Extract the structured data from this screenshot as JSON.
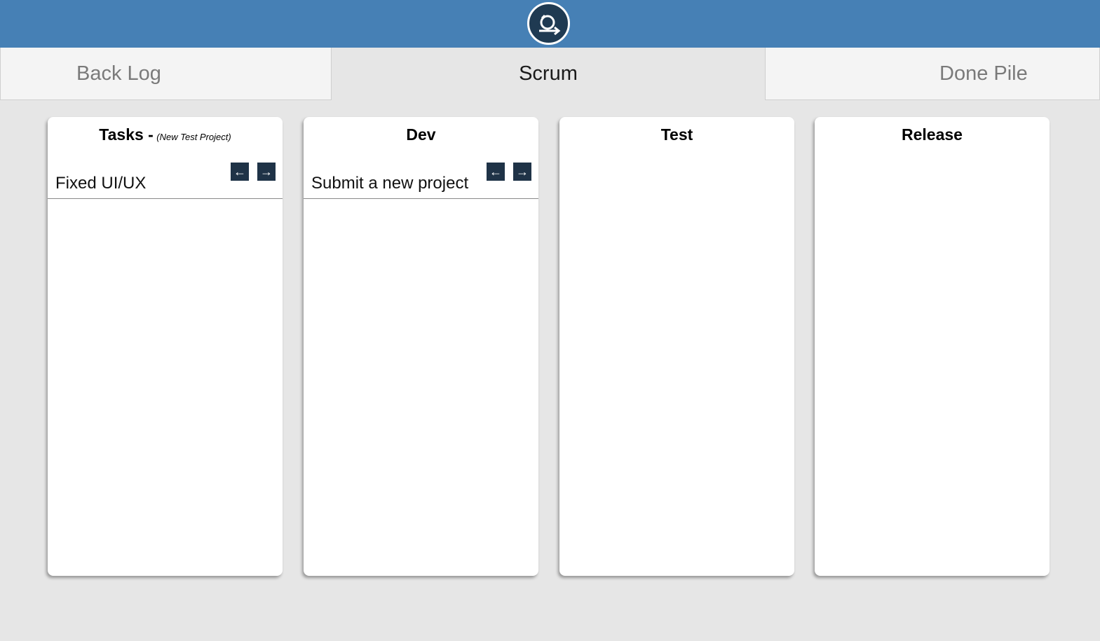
{
  "app": {
    "logo_icon": "scrum-loop-icon"
  },
  "tabs": [
    {
      "label": "Back Log",
      "active": false
    },
    {
      "label": "Scrum",
      "active": true
    },
    {
      "label": "Done Pile",
      "active": false
    }
  ],
  "columns": [
    {
      "title": "Tasks -",
      "subtitle": "(New Test Project)",
      "cards": [
        {
          "text": "Fixed UI/UX"
        }
      ]
    },
    {
      "title": "Dev",
      "cards": [
        {
          "text": "Submit a new project"
        }
      ]
    },
    {
      "title": "Test",
      "cards": []
    },
    {
      "title": "Release",
      "cards": []
    }
  ],
  "icons": {
    "move_left": "arrow-left-icon",
    "move_right": "arrow-right-icon"
  },
  "colors": {
    "header": "#4680b5",
    "logo_bg": "#1f3a52",
    "arrow_btn": "#1f3347",
    "page_bg": "#e6e6e6"
  }
}
